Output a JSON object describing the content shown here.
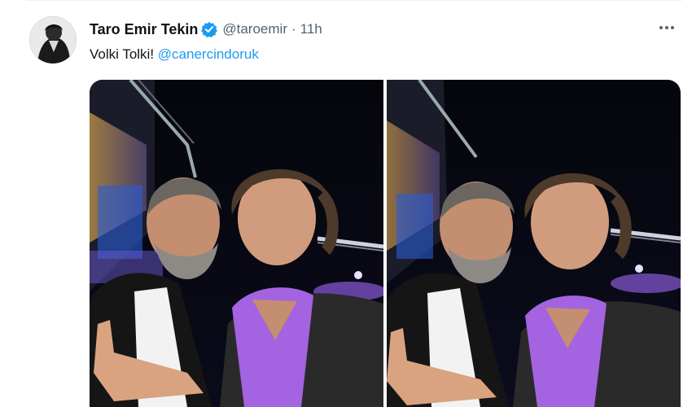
{
  "tweet": {
    "author_name": "Taro Emir Tekin",
    "handle": "@taroemir",
    "separator": "·",
    "time": "11h",
    "text": "Volki Tolki!",
    "mention": "@canercindoruk",
    "more_icon": "more-horizontal-icon",
    "verified_icon": "verified-badge-icon"
  },
  "colors": {
    "text": "#0f1419",
    "secondary": "#536471",
    "link": "#1d9bf0",
    "verified": "#1d9bf0"
  }
}
